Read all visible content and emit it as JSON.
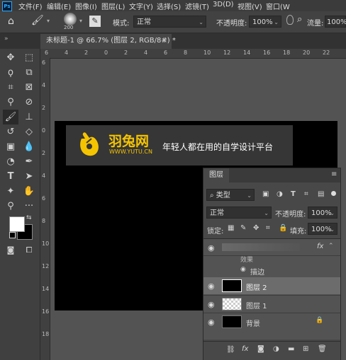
{
  "app": {
    "logo": "Ps"
  },
  "menu": [
    "文件(F)",
    "编辑(E)",
    "图像(I)",
    "图层(L)",
    "文字(Y)",
    "选择(S)",
    "滤镜(T)",
    "3D(D)",
    "视图(V)",
    "窗口(W"
  ],
  "options": {
    "brush_size": "200",
    "mode_label": "模式:",
    "mode_value": "正常",
    "opacity_label": "不透明度:",
    "opacity_value": "100%",
    "flow_label": "流量:",
    "flow_value": "100%"
  },
  "document": {
    "tab_title": "未标题-1 @ 66.7% (图层 2, RGB/8#) *",
    "close": "×"
  },
  "ruler_top": [
    "6",
    "4",
    "2",
    "0",
    "2",
    "4",
    "6",
    "8",
    "10",
    "12",
    "14",
    "16",
    "18",
    "20",
    "22"
  ],
  "ruler_left": [
    "6",
    "4",
    "2",
    "0",
    "2",
    "4",
    "6",
    "8",
    "10",
    "12",
    "14",
    "16",
    "18"
  ],
  "watermark": {
    "brand": "羽兔网",
    "url": "WWW.YUTU.CN",
    "slogan": "年轻人都在用的自学设计平台"
  },
  "layers_panel": {
    "tab": "图层",
    "filter_kind": "类型",
    "blend_mode": "正常",
    "opacity_label": "不透明度:",
    "opacity_value": "100%",
    "lock_label": "锁定:",
    "fill_label": "填充:",
    "fill_value": "100%",
    "effects_label": "效果",
    "stroke_label": "描边",
    "fx": "fx",
    "layers": [
      {
        "name": "图层 2",
        "selected": true,
        "thumb": "black"
      },
      {
        "name": "图层 1",
        "selected": false,
        "thumb": "transparent"
      },
      {
        "name": "背景",
        "selected": false,
        "thumb": "black",
        "locked": true
      }
    ]
  }
}
